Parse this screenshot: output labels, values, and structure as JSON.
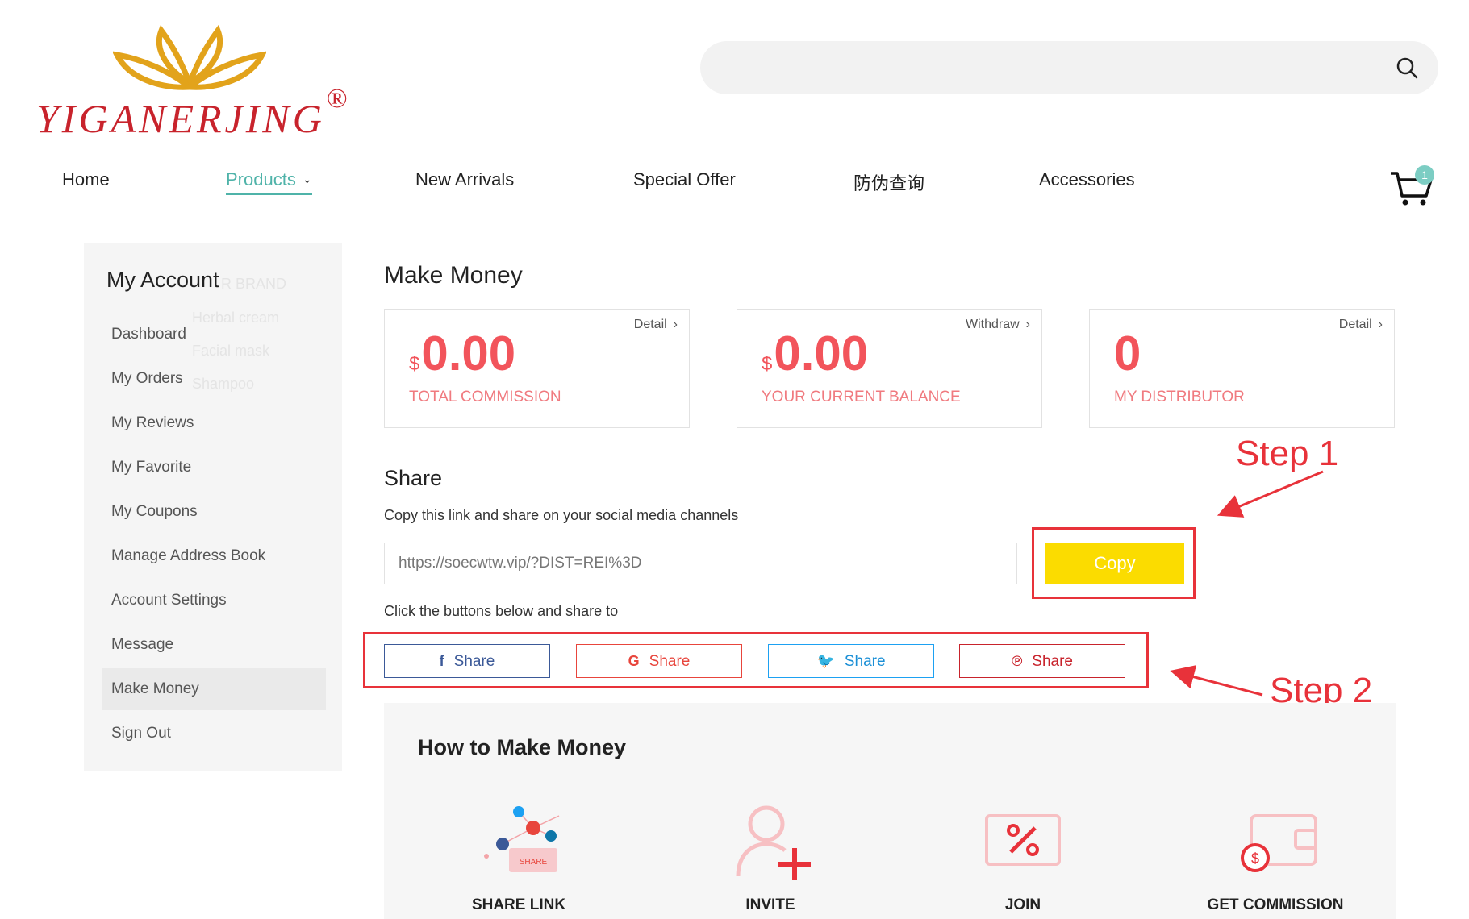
{
  "brand": {
    "name": "YIGANERJING",
    "mark": "®"
  },
  "search": {
    "icon": "search-icon"
  },
  "nav": {
    "items": [
      "Home",
      "Products",
      "New Arrivals",
      "Special Offer",
      "防伪查询",
      "Accessories"
    ],
    "active": "Products",
    "cart_count": "1"
  },
  "sidebar": {
    "title": "My Account",
    "items": [
      "Dashboard",
      "My Orders",
      "My Reviews",
      "My Favorite",
      "My Coupons",
      "Manage Address Book",
      "Account Settings",
      "Message",
      "Make Money",
      "Sign Out"
    ],
    "active": "Make Money"
  },
  "ghost_menu": {
    "brand": "R BRAND",
    "items": [
      "Herbal cream",
      "Facial mask",
      "Shampoo"
    ]
  },
  "main": {
    "title": "Make Money",
    "stats": [
      {
        "currency": "$",
        "value": "0.00",
        "label": "TOTAL COMMISSION",
        "link": "Detail"
      },
      {
        "currency": "$",
        "value": "0.00",
        "label": "YOUR CURRENT BALANCE",
        "link": "Withdraw"
      },
      {
        "currency": "",
        "value": "0",
        "label": "MY DISTRIBUTOR",
        "link": "Detail"
      }
    ],
    "share": {
      "title": "Share",
      "description": "Copy this link and share on your social media channels",
      "link_value": "https://soecwtw.vip/?DIST=REI%3D",
      "copy_label": "Copy",
      "share_to": "Click the buttons below and share to",
      "buttons": [
        {
          "icon": "f",
          "label": "Share"
        },
        {
          "icon": "G",
          "label": "Share"
        },
        {
          "icon": "🐦",
          "label": "Share"
        },
        {
          "icon": "℗",
          "label": "Share"
        }
      ]
    },
    "annotations": {
      "step1": "Step 1",
      "step2": "Step 2"
    },
    "howto": {
      "title": "How to Make Money",
      "share_badge": "SHARE",
      "steps": [
        "SHARE LINK",
        "INVITE",
        "JOIN",
        "GET COMMISSION"
      ]
    }
  },
  "colors": {
    "accent": "#4fb3a9",
    "highlight": "#f2545b",
    "copy": "#fbdc00",
    "annotation": "#e8323a"
  }
}
